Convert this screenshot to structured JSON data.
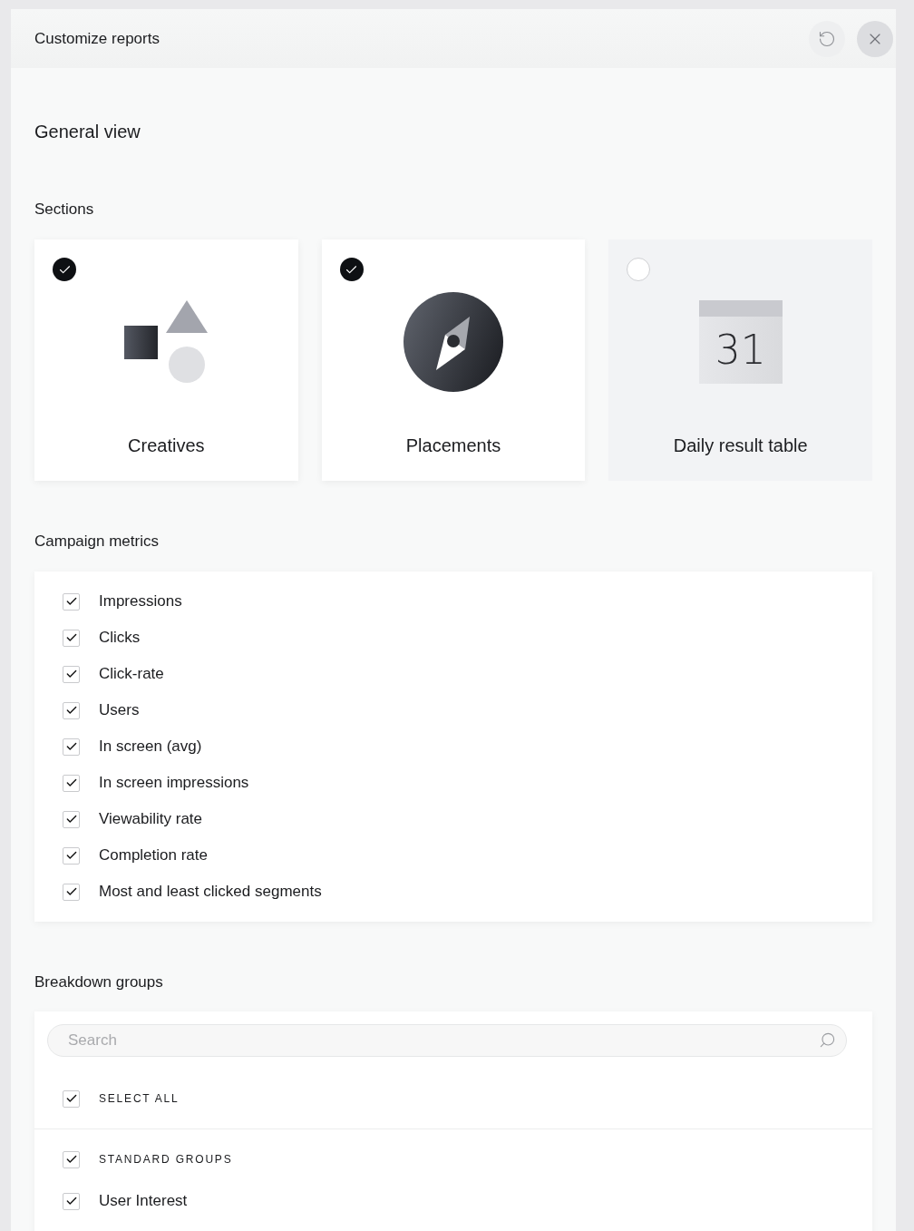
{
  "window": {
    "title": "Customize reports"
  },
  "general_view": {
    "title": "General view"
  },
  "sections": {
    "title": "Sections",
    "items": [
      {
        "label": "Creatives",
        "kind": "shapes",
        "selected": true
      },
      {
        "label": "Placements",
        "kind": "compass",
        "selected": true
      },
      {
        "label": "Daily result table",
        "kind": "calendar",
        "date": "31",
        "selected": false
      }
    ]
  },
  "campaign_metrics": {
    "title": "Campaign metrics",
    "items": [
      {
        "label": "Impressions",
        "checked": true
      },
      {
        "label": "Clicks",
        "checked": true
      },
      {
        "label": "Click-rate",
        "checked": true
      },
      {
        "label": "Users",
        "checked": true
      },
      {
        "label": "In screen (avg)",
        "checked": true
      },
      {
        "label": "In screen impressions",
        "checked": true
      },
      {
        "label": "Viewability rate",
        "checked": true
      },
      {
        "label": "Completion rate",
        "checked": true
      },
      {
        "label": "Most and least clicked segments",
        "checked": true
      }
    ]
  },
  "breakdown_groups": {
    "title": "Breakdown groups",
    "search": {
      "placeholder": "Search"
    },
    "select_all": {
      "label": "SELECT ALL",
      "checked": true
    },
    "items": [
      {
        "kind": "group",
        "label": "STANDARD GROUPS",
        "checked": true
      },
      {
        "kind": "item",
        "label": "User Interest",
        "checked": true
      }
    ]
  }
}
